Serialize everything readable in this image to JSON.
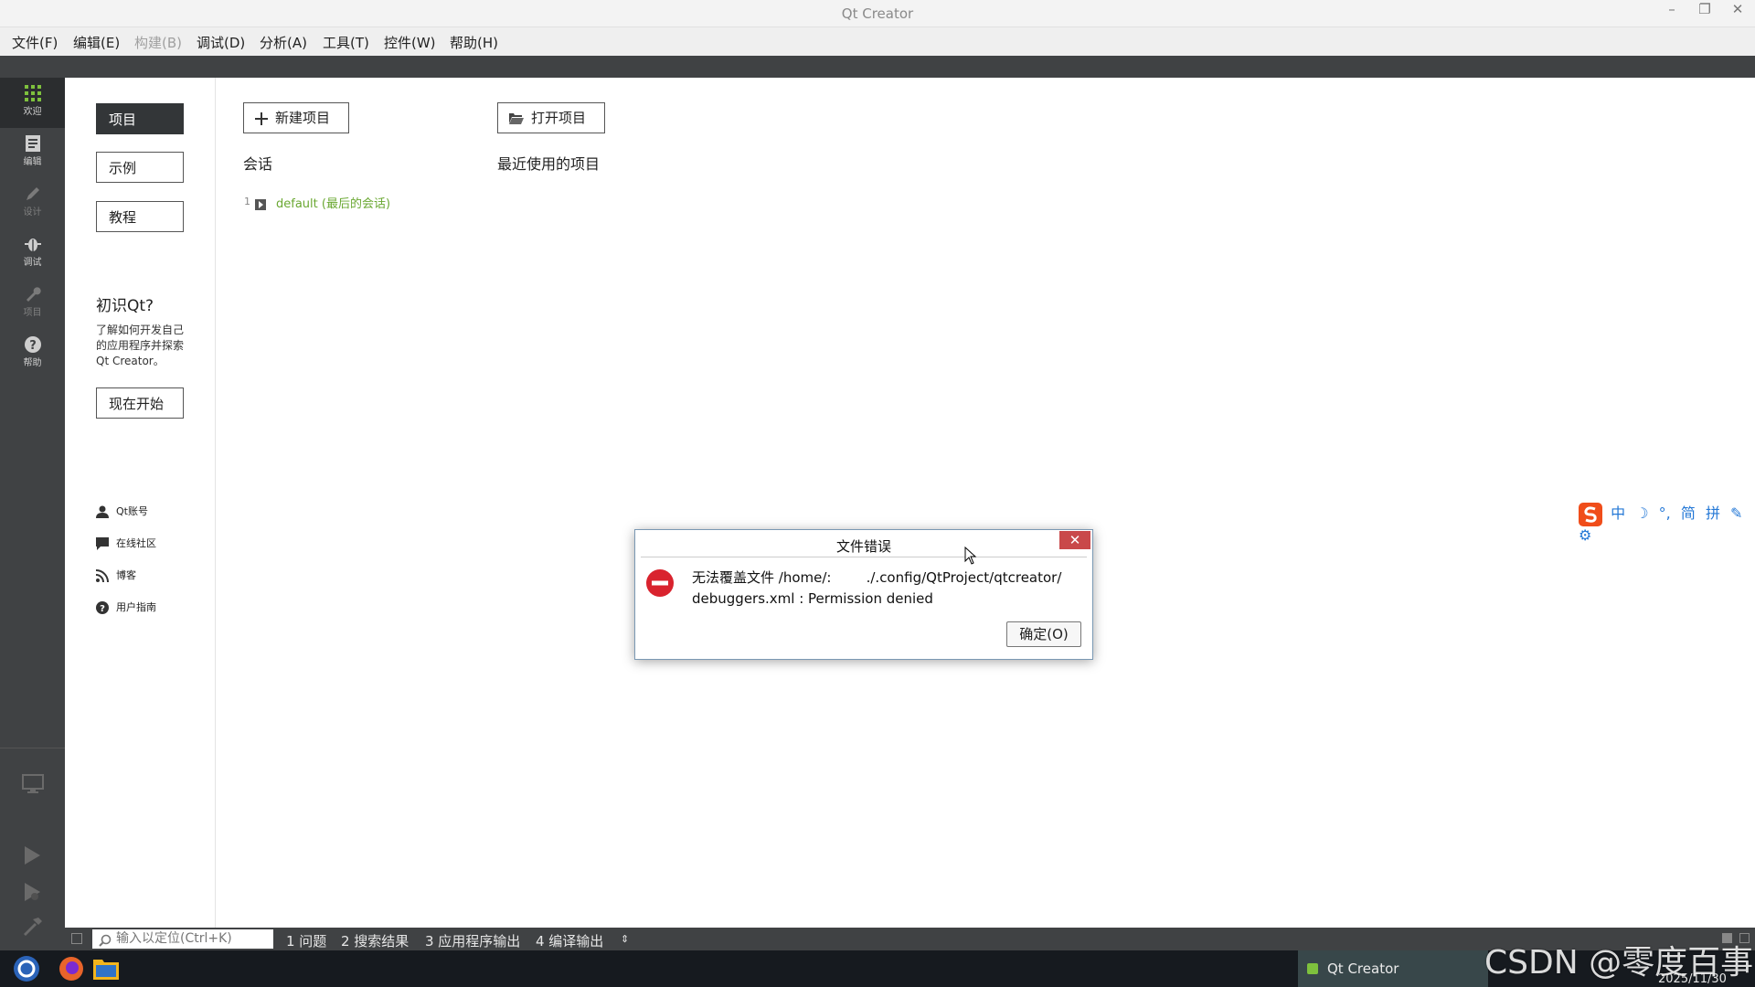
{
  "window": {
    "title": "Qt Creator"
  },
  "menu": [
    "文件(F)",
    "编辑(E)",
    "构建(B)",
    "调试(D)",
    "分析(A)",
    "工具(T)",
    "控件(W)",
    "帮助(H)"
  ],
  "modes": [
    {
      "label": "欢迎",
      "icon": "grid-icon"
    },
    {
      "label": "编辑",
      "icon": "document-icon"
    },
    {
      "label": "设计",
      "icon": "pencil-icon"
    },
    {
      "label": "调试",
      "icon": "bug-icon"
    },
    {
      "label": "项目",
      "icon": "wrench-icon"
    },
    {
      "label": "帮助",
      "icon": "help-icon"
    }
  ],
  "welcome": {
    "tabs": [
      "项目",
      "示例",
      "教程"
    ],
    "intro": {
      "title": "初识Qt?",
      "text_lines": [
        "了解如何开发自己",
        "的应用程序并探索",
        "Qt Creator。"
      ],
      "start": "现在开始"
    },
    "links": [
      "Qt账号",
      "在线社区",
      "博客",
      "用户指南"
    ]
  },
  "main": {
    "new_project": "新建项目",
    "open_project": "打开项目",
    "sessions_heading": "会话",
    "recent_heading": "最近使用的项目",
    "session_item": {
      "index": "1",
      "name": "default (最后的会话)"
    }
  },
  "dialog": {
    "title": "文件错误",
    "close": "✕",
    "message_line1": "无法覆盖文件 /home/:        ./.config/QtProject/qtcreator/",
    "message_line2": "debuggers.xml : Permission denied",
    "ok": "确定(O)"
  },
  "output": {
    "locator_placeholder": "输入以定位(Ctrl+K)",
    "tabs": [
      "1 问题",
      "2 搜索结果",
      "3 应用程序输出",
      "4 编译输出"
    ]
  },
  "taskbar": {
    "app": "Qt Creator",
    "date": "2025/11/30"
  },
  "ime": [
    "中",
    "☽",
    "°,",
    "简",
    "拼",
    "✎",
    "⚙"
  ],
  "watermark": "CSDN @零度百事",
  "colors": {
    "session_link": "#6aa832",
    "error_red": "#d9232e",
    "dark_bar": "#404244"
  }
}
